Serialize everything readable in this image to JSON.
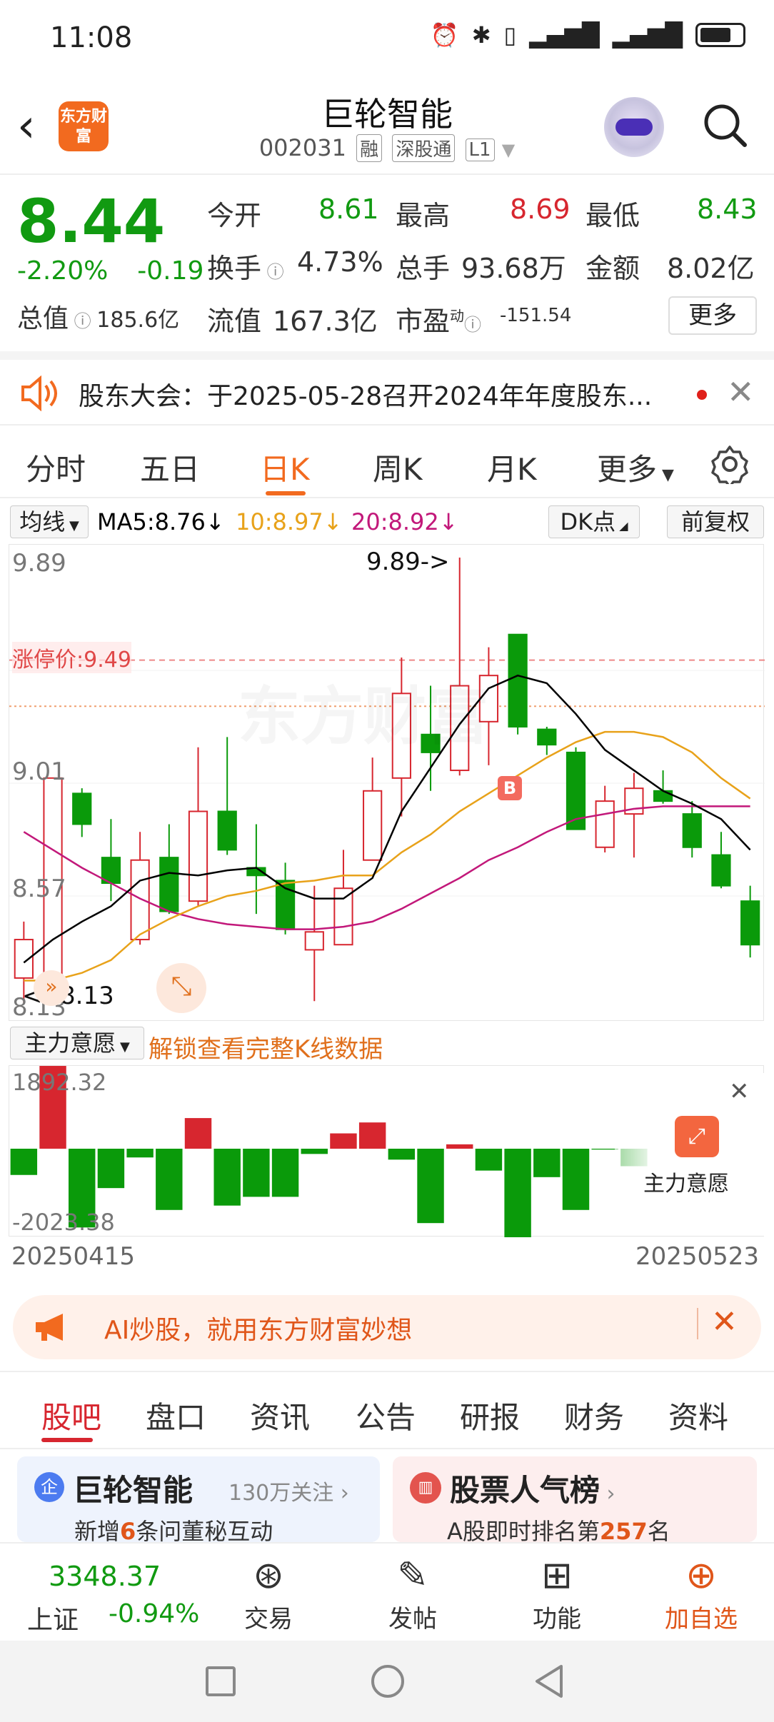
{
  "status_bar": {
    "time": "11:08"
  },
  "header": {
    "logo_text": "东方财富",
    "title": "巨轮智能",
    "code": "002031",
    "tags": [
      "融",
      "深股通",
      "L1"
    ]
  },
  "quote": {
    "price": "8.44",
    "change_pct": "-2.20%",
    "change": "-0.19",
    "total_label": "总值",
    "total_value": "185.6亿",
    "open_label": "今开",
    "open_value": "8.61",
    "high_label": "最高",
    "high_value": "8.69",
    "low_label": "最低",
    "low_value": "8.43",
    "turnover_label": "换手",
    "turnover_value": "4.73%",
    "volume_label": "总手",
    "volume_value": "93.68万",
    "amount_label": "金额",
    "amount_value": "8.02亿",
    "float_label": "流值",
    "float_value": "167.3亿",
    "pe_label": "市盈",
    "pe_sup": "动",
    "pe_value": "-151.54",
    "more_label": "更多"
  },
  "notice": {
    "text": "股东大会：于2025-05-28召开2024年年度股东..."
  },
  "period_tabs": [
    "分时",
    "五日",
    "日K",
    "周K",
    "月K",
    "更多"
  ],
  "active_period": "日K",
  "ma": {
    "selector": "均线",
    "ma5": "MA5:8.76↓",
    "ma10": "10:8.97↓",
    "ma20": "20:8.92↓",
    "dk_label": "DK点",
    "fq_label": "前复权",
    "colors": {
      "ma5": "#000000",
      "ma10": "#e8a21a",
      "ma20": "#c2187a"
    }
  },
  "kline": {
    "y_labels": [
      "9.89",
      "9.01",
      "8.57",
      "8.13"
    ],
    "limit_up_label": "涨停价:9.49",
    "max_marker": "9.89->",
    "min_marker": "<--8.13",
    "b_marker": "B",
    "watermark": "东方财富"
  },
  "chart_data": {
    "type": "candlestick",
    "y_range": [
      8.13,
      9.89
    ],
    "candles": [
      {
        "o": 8.25,
        "c": 8.4,
        "h": 8.47,
        "l": 8.15
      },
      {
        "o": 8.2,
        "c": 9.03,
        "h": 9.03,
        "l": 8.2
      },
      {
        "o": 8.97,
        "c": 8.85,
        "h": 8.99,
        "l": 8.8
      },
      {
        "o": 8.72,
        "c": 8.62,
        "h": 8.87,
        "l": 8.55
      },
      {
        "o": 8.4,
        "c": 8.71,
        "h": 8.82,
        "l": 8.38
      },
      {
        "o": 8.72,
        "c": 8.51,
        "h": 8.85,
        "l": 8.5
      },
      {
        "o": 8.55,
        "c": 8.9,
        "h": 9.15,
        "l": 8.53
      },
      {
        "o": 8.9,
        "c": 8.75,
        "h": 9.19,
        "l": 8.73
      },
      {
        "o": 8.68,
        "c": 8.65,
        "h": 8.85,
        "l": 8.5
      },
      {
        "o": 8.63,
        "c": 8.44,
        "h": 8.7,
        "l": 8.42
      },
      {
        "o": 8.36,
        "c": 8.43,
        "h": 8.61,
        "l": 8.16
      },
      {
        "o": 8.38,
        "c": 8.6,
        "h": 8.75,
        "l": 8.38
      },
      {
        "o": 8.71,
        "c": 8.98,
        "h": 9.11,
        "l": 8.71
      },
      {
        "o": 9.03,
        "c": 9.36,
        "h": 9.5,
        "l": 8.88
      },
      {
        "o": 9.2,
        "c": 9.13,
        "h": 9.39,
        "l": 8.98
      },
      {
        "o": 9.06,
        "c": 9.39,
        "h": 9.89,
        "l": 9.04
      },
      {
        "o": 9.25,
        "c": 9.43,
        "h": 9.54,
        "l": 9.08
      },
      {
        "o": 9.59,
        "c": 9.23,
        "h": 9.59,
        "l": 9.2
      },
      {
        "o": 9.22,
        "c": 9.16,
        "h": 9.23,
        "l": 9.12
      },
      {
        "o": 9.13,
        "c": 8.83,
        "h": 9.15,
        "l": 8.83
      },
      {
        "o": 8.76,
        "c": 8.94,
        "h": 9.0,
        "l": 8.74
      },
      {
        "o": 8.89,
        "c": 8.99,
        "h": 9.05,
        "l": 8.72
      },
      {
        "o": 8.98,
        "c": 8.94,
        "h": 9.06,
        "l": 8.93
      },
      {
        "o": 8.89,
        "c": 8.76,
        "h": 8.94,
        "l": 8.72
      },
      {
        "o": 8.73,
        "c": 8.61,
        "h": 8.82,
        "l": 8.6
      },
      {
        "o": 8.55,
        "c": 8.38,
        "h": 8.61,
        "l": 8.33
      }
    ],
    "ma5": [
      8.31,
      8.4,
      8.47,
      8.53,
      8.63,
      8.66,
      8.65,
      8.67,
      8.68,
      8.6,
      8.56,
      8.56,
      8.64,
      8.9,
      9.07,
      9.24,
      9.38,
      9.43,
      9.4,
      9.28,
      9.14,
      9.06,
      8.98,
      8.93,
      8.87,
      8.75
    ],
    "ma10": [
      8.24,
      8.24,
      8.27,
      8.32,
      8.42,
      8.48,
      8.53,
      8.57,
      8.59,
      8.62,
      8.63,
      8.65,
      8.65,
      8.74,
      8.81,
      8.9,
      8.97,
      9.04,
      9.11,
      9.17,
      9.21,
      9.21,
      9.19,
      9.13,
      9.03,
      8.95
    ],
    "ma20": [
      8.82,
      8.75,
      8.68,
      8.62,
      8.56,
      8.51,
      8.48,
      8.46,
      8.45,
      8.44,
      8.44,
      8.45,
      8.47,
      8.52,
      8.58,
      8.64,
      8.71,
      8.76,
      8.82,
      8.87,
      8.89,
      8.91,
      8.92,
      8.92,
      8.92,
      8.92
    ]
  },
  "fund": {
    "selector": "主力意愿",
    "unlock_text": "解锁查看完整K线数据",
    "max_label": "1892.32",
    "min_label": "-2023.38",
    "badge_label": "主力意愿",
    "start_date": "20250415",
    "end_date": "20250523",
    "range": [
      -2023.38,
      1892.32
    ],
    "values": [
      -600,
      1892,
      -1800,
      -900,
      -200,
      -1400,
      700,
      -1300,
      -1100,
      -1100,
      -120,
      350,
      600,
      -250,
      -1700,
      100,
      -500,
      -2023,
      -650,
      -1400,
      -20,
      -400,
      0,
      0,
      0,
      0
    ]
  },
  "ai_banner": {
    "text": "AI炒股，就用东方财富妙想"
  },
  "section_tabs": [
    "股吧",
    "盘口",
    "资讯",
    "公告",
    "研报",
    "财务",
    "资料"
  ],
  "cards": {
    "left_title": "巨轮智能",
    "left_follow": "130万关注",
    "left_sub_prefix": "新增",
    "left_sub_num": "6",
    "left_sub_suffix": "条问董秘互动",
    "right_title": "股票人气榜",
    "right_sub_prefix": "A股即时排名第",
    "right_sub_num": "257",
    "right_sub_suffix": "名"
  },
  "bottom_nav": {
    "index_value": "3348.37",
    "index_name": "上证",
    "index_change": "-0.94%",
    "items": [
      "交易",
      "发帖",
      "功能",
      "加自选"
    ]
  }
}
